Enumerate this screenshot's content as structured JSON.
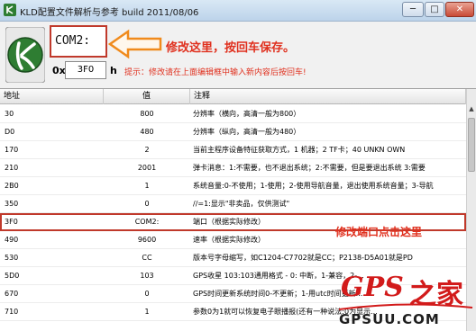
{
  "window": {
    "title": "KLD配置文件解析与参考 build 2011/08/06",
    "minimize_glyph": "─",
    "maximize_glyph": "□",
    "close_glyph": "✕"
  },
  "toolbar": {
    "com_value": "COM2:",
    "annotation_save": "修改这里，按回车保存。",
    "address_prefix": "0x",
    "address_value": "3F0",
    "address_suffix": "h",
    "hint": "提示：修改请在上面编辑框中输入新内容后按回车!"
  },
  "table": {
    "headers": [
      "地址",
      "值",
      "注释"
    ],
    "rows": [
      {
        "addr": "30",
        "value": "800",
        "note": "分辨率（横向，高清一般为800）"
      },
      {
        "addr": "D0",
        "value": "480",
        "note": "分辨率（纵向，高清一般为480）"
      },
      {
        "addr": "170",
        "value": "2",
        "note": "当前主程序设备特征获取方式，1 机器；2 TF卡；40 UNKN OWN"
      },
      {
        "addr": "210",
        "value": "2001",
        "note": "弹卡消息：1:不需要，也不退出系统；2:不需要，但是要退出系统 3:需要"
      },
      {
        "addr": "2B0",
        "value": "1",
        "note": "系统音量:0-不使用；1-使用；2-使用导航音量，退出使用系统音量；3-导航"
      },
      {
        "addr": "350",
        "value": "0",
        "note": "//=1:显示\"非卖品，仅供测试\""
      },
      {
        "addr": "3F0",
        "value": "COM2:",
        "note": "端口（根据实际修改）"
      },
      {
        "addr": "490",
        "value": "9600",
        "note": "速率（根据实际修改）"
      },
      {
        "addr": "530",
        "value": "CC",
        "note": "版本号字母缩写，如C1204-C7702就是CC；P2138-D5A01就是PD"
      },
      {
        "addr": "5D0",
        "value": "103",
        "note": "GPS收星 103:103通用格式 - 0: 中断，1-兼容，2-..."
      },
      {
        "addr": "670",
        "value": "0",
        "note": "GPS时间更新系统时间0-不更新；1-用utc时间更新..."
      },
      {
        "addr": "710",
        "value": "1",
        "note": "参数0为1就可以恢复电子眼播报(还有一种说法:0为显示..."
      }
    ]
  },
  "annotations": {
    "port_hint": "修改端口点击这里"
  },
  "watermark": {
    "brand": "GPS",
    "brand_cn": "之家",
    "url": "GPSUU.COM"
  },
  "colors": {
    "accent_red": "#c0392b",
    "annotation_red": "#e0301e",
    "logo_green": "#2e7d32"
  }
}
